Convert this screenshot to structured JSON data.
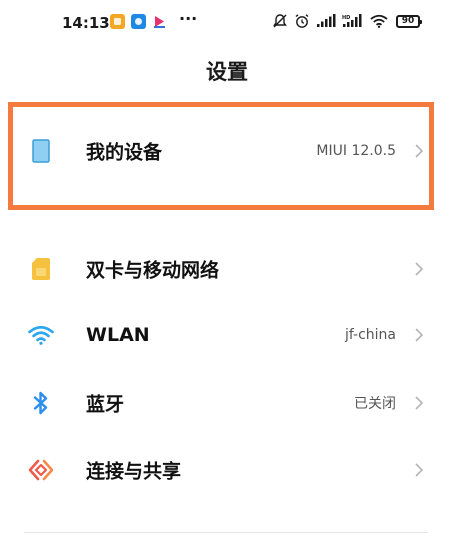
{
  "status_bar": {
    "time": "14:13",
    "battery_level": "90",
    "colors": {
      "notif_orange": "#f5a623",
      "notif_blue": "#1e88e5",
      "notif_pink": "#e5316d"
    }
  },
  "header": {
    "title": "设置"
  },
  "settings": {
    "my_device": {
      "label": "我的设备",
      "value": "MIUI 12.0.5",
      "icon": "device-icon",
      "color": "#5bb0e0"
    },
    "sim_network": {
      "label": "双卡与移动网络",
      "value": "",
      "icon": "sim-card-icon",
      "color": "#f6c23e"
    },
    "wlan": {
      "label": "WLAN",
      "value": "jf-china",
      "icon": "wifi-icon",
      "color": "#2aa7ee"
    },
    "bluetooth": {
      "label": "蓝牙",
      "value": "已关闭",
      "icon": "bluetooth-icon",
      "color": "#2d8ef0"
    },
    "connection_share": {
      "label": "连接与共享",
      "value": "",
      "icon": "share-icon",
      "color": "#f05a4a"
    }
  },
  "highlight_color": "#f47a3d"
}
